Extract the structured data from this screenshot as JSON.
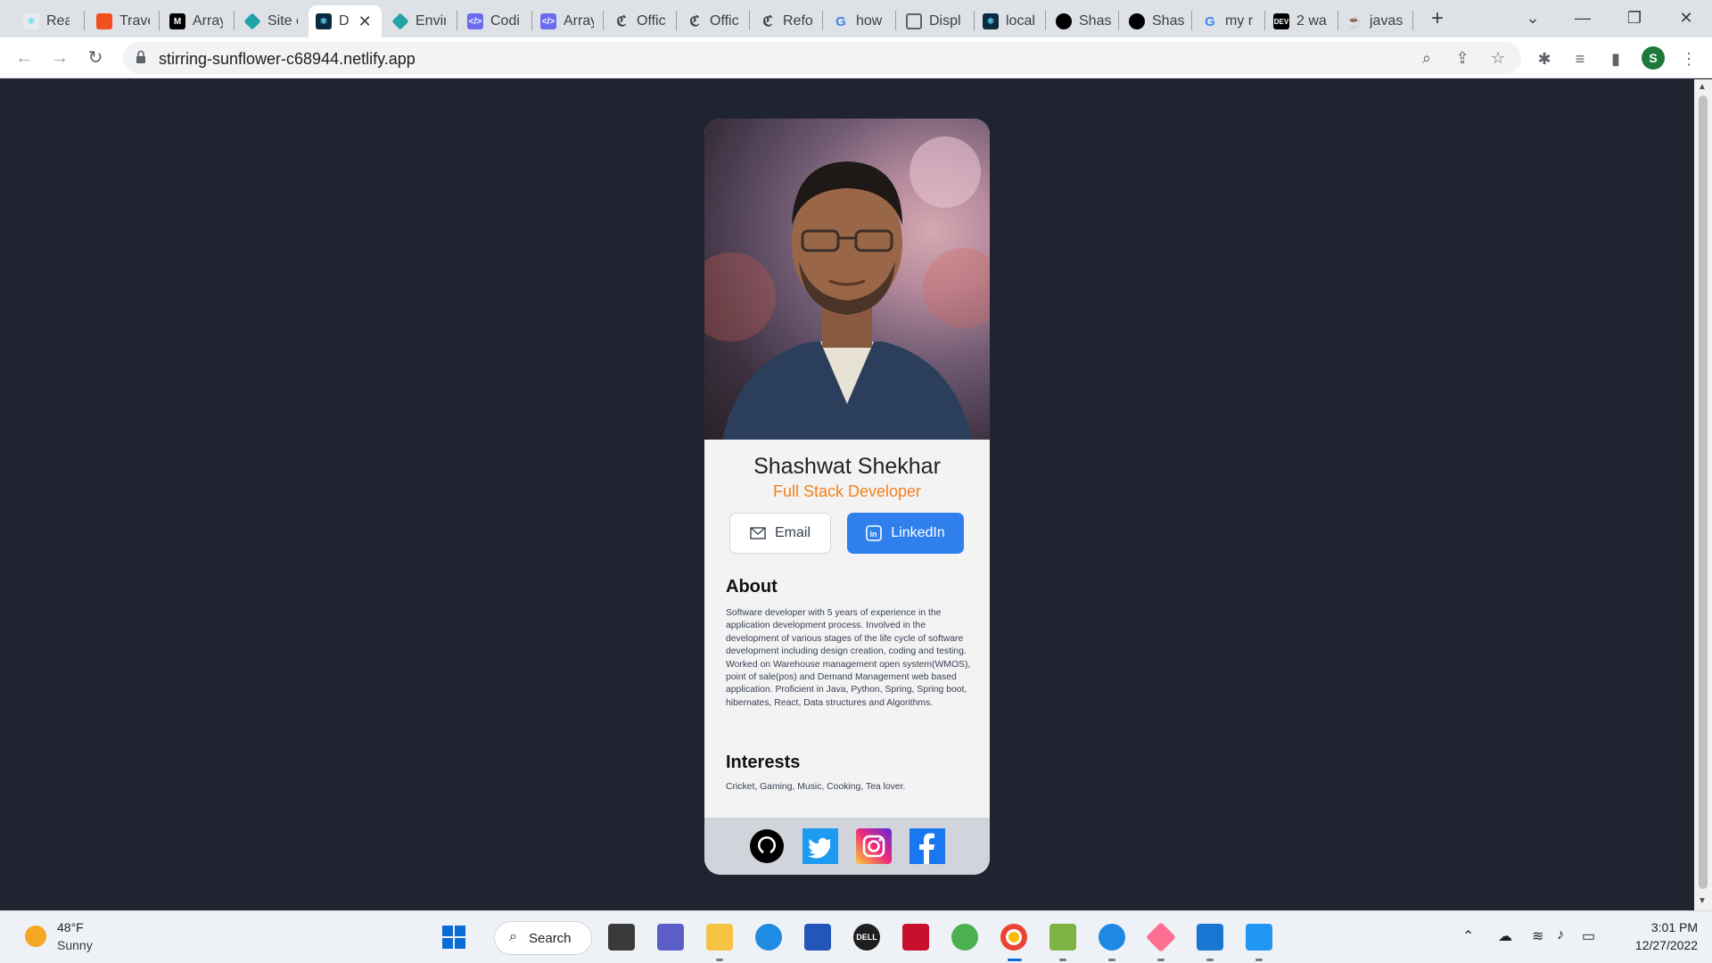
{
  "browser": {
    "tabs": [
      {
        "label": "React",
        "icon": "react-icon",
        "color": "#61dafb"
      },
      {
        "label": "Travel",
        "icon": "figma-icon",
        "color": "#f24e1e"
      },
      {
        "label": "Array",
        "icon": "medium-icon",
        "color": "#000000"
      },
      {
        "label": "Site c",
        "icon": "netlify-icon",
        "color": "#20a4a5"
      },
      {
        "label": "D",
        "icon": "react-icon",
        "color": "#0b2a3d"
      },
      {
        "label": "Envir",
        "icon": "netlify-icon",
        "color": "#20a4a5"
      },
      {
        "label": "Codi",
        "icon": "code-icon",
        "color": "#6b6bf0"
      },
      {
        "label": "Array",
        "icon": "code-icon",
        "color": "#6b6bf0"
      },
      {
        "label": "Offic",
        "icon": "c-icon",
        "color": "#3c4043"
      },
      {
        "label": "Offic",
        "icon": "c-icon",
        "color": "#3c4043"
      },
      {
        "label": "Refo",
        "icon": "c-icon",
        "color": "#3c4043"
      },
      {
        "label": "how",
        "icon": "google-icon",
        "color": "#4285f4"
      },
      {
        "label": "Displ",
        "icon": "display-icon",
        "color": "#5f6368"
      },
      {
        "label": "local",
        "icon": "react-icon",
        "color": "#0b2a3d"
      },
      {
        "label": "Shas",
        "icon": "github-icon",
        "color": "#000000"
      },
      {
        "label": "Shas",
        "icon": "github-icon",
        "color": "#000000"
      },
      {
        "label": "my r",
        "icon": "google-icon",
        "color": "#4285f4"
      },
      {
        "label": "2 wa",
        "icon": "dev-icon",
        "color": "#000000"
      },
      {
        "label": "javas",
        "icon": "java-icon",
        "color": "#e76f00"
      }
    ],
    "active_tab_index": 4,
    "new_tab_label": "+",
    "url": "stirring-sunflower-c68944.netlify.app",
    "profile_initial": "S"
  },
  "card": {
    "name": "Shashwat Shekhar",
    "role": "Full Stack Developer",
    "email_label": "Email",
    "linkedin_label": "LinkedIn",
    "about_title": "About",
    "about_text": "Software developer with 5 years of experience in the application development process. Involved in the development of various stages of the life cycle of software development including design creation, coding and testing. Worked on Warehouse management open system(WMOS), point of sale(pos) and Demand Management web based application. Proficient in Java, Python, Spring, Spring boot, hibernates, React, Data structures and Algorithms.",
    "interests_title": "Interests",
    "interests_text": "Cricket, Gaming, Music, Cooking, Tea lover.",
    "social": [
      "github-icon",
      "twitter-icon",
      "instagram-icon",
      "facebook-icon"
    ],
    "colors": {
      "accent": "#f3801a",
      "linkedin": "#2f80ed",
      "page_bg": "#202431"
    }
  },
  "taskbar": {
    "weather_temp": "48°F",
    "weather_desc": "Sunny",
    "search_label": "Search",
    "time": "3:01 PM",
    "date": "12/27/2022"
  }
}
